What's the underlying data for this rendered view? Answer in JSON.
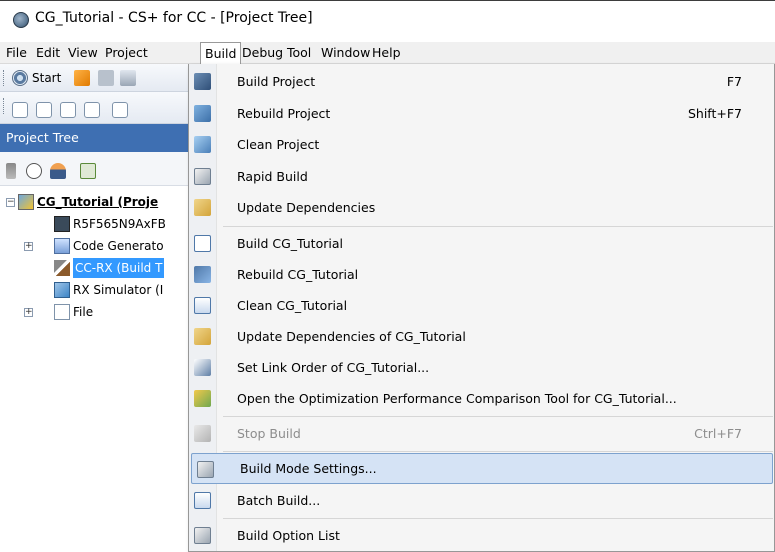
{
  "window": {
    "title": "CG_Tutorial - CS+ for CC - [Project Tree]"
  },
  "menubar": {
    "items": [
      "File",
      "Edit",
      "View",
      "Project",
      "Build",
      "Debug",
      "Tool",
      "Window",
      "Help"
    ],
    "active": "Build"
  },
  "toolbar": {
    "start_label": "Start"
  },
  "pane": {
    "title": "Project Tree"
  },
  "tree": {
    "items": [
      "CG_Tutorial (Proje",
      "R5F565N9AxFB",
      "Code Generato",
      "CC-RX (Build T",
      "RX Simulator (I",
      "File"
    ]
  },
  "build_menu": {
    "items": [
      {
        "label": "Build Project",
        "shortcut": "F7",
        "icon": "build-project-icon"
      },
      {
        "label": "Rebuild Project",
        "shortcut": "Shift+F7",
        "icon": "rebuild-project-icon"
      },
      {
        "label": "Clean Project",
        "shortcut": "",
        "icon": "clean-project-icon"
      },
      {
        "label": "Rapid Build",
        "shortcut": "",
        "icon": "rapid-build-icon"
      },
      {
        "label": "Update Dependencies",
        "shortcut": "",
        "icon": "update-dependencies-icon"
      },
      {
        "label": "Build CG_Tutorial",
        "shortcut": "",
        "icon": "build-icon"
      },
      {
        "label": "Rebuild CG_Tutorial",
        "shortcut": "",
        "icon": "rebuild-icon"
      },
      {
        "label": "Clean CG_Tutorial",
        "shortcut": "",
        "icon": "clean-icon"
      },
      {
        "label": "Update Dependencies of CG_Tutorial",
        "shortcut": "",
        "icon": "update-dependencies-icon"
      },
      {
        "label": "Set Link Order of CG_Tutorial...",
        "shortcut": "",
        "icon": "link-order-icon"
      },
      {
        "label": "Open the Optimization Performance Comparison Tool for CG_Tutorial...",
        "shortcut": "",
        "icon": "optimization-chart-icon"
      },
      {
        "label": "Stop Build",
        "shortcut": "Ctrl+F7",
        "icon": "stop-build-icon"
      },
      {
        "label": "Build Mode Settings...",
        "shortcut": "",
        "icon": "build-mode-icon"
      },
      {
        "label": "Batch Build...",
        "shortcut": "",
        "icon": "batch-build-icon"
      },
      {
        "label": "Build Option List",
        "shortcut": "",
        "icon": "build-option-list-icon"
      }
    ],
    "highlighted": "Build Mode Settings...",
    "disabled": [
      "Stop Build"
    ]
  }
}
